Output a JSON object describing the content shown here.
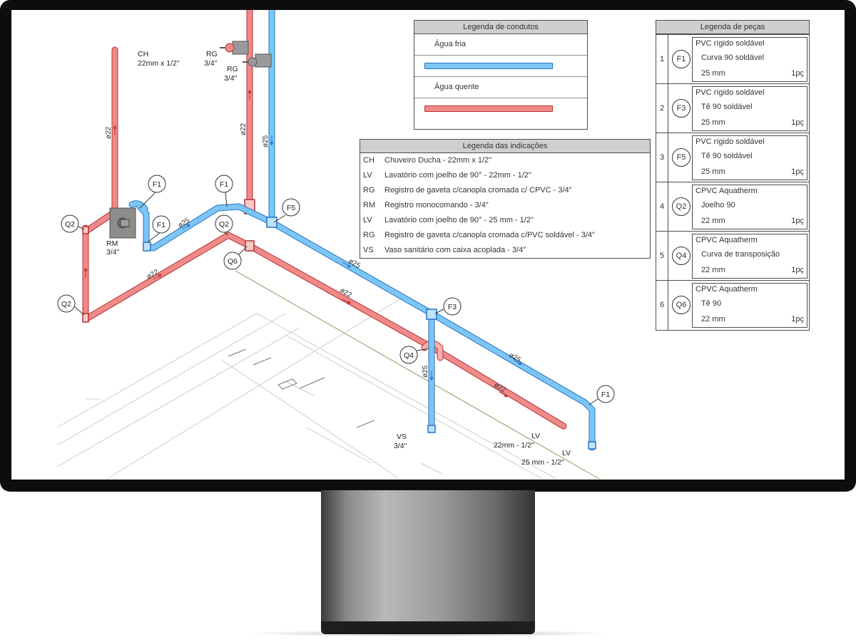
{
  "colors": {
    "cold": "#5bb7ef",
    "cold_dark": "#2a72c4",
    "hot": "#ef7f7f",
    "hot_dark": "#b83030"
  },
  "legend_conduits": {
    "title": "Legenda de condutos",
    "items": [
      {
        "label": "Água fria"
      },
      {
        "label": "Água quente"
      }
    ]
  },
  "legend_indications": {
    "title": "Legenda das indicações",
    "items": [
      {
        "code": "CH",
        "desc": "Chuveiro Ducha - 22mm x 1/2\""
      },
      {
        "code": "LV",
        "desc": "Lavatório com joelho de 90° - 22mm - 1/2\""
      },
      {
        "code": "RG",
        "desc": "Registro de gaveta c/canopla cromada c/ CPVC - 3/4\""
      },
      {
        "code": "RM",
        "desc": "Registro monocomando - 3/4\""
      },
      {
        "code": "LV",
        "desc": "Lavatório com joelho de 90° - 25 mm - 1/2\""
      },
      {
        "code": "RG",
        "desc": "Registro de gaveta c/canopla cromada c/PVC soldável - 3/4\""
      },
      {
        "code": "VS",
        "desc": "Vaso sanitário com caixa acoplada - 3/4\""
      }
    ]
  },
  "legend_parts": {
    "title": "Legenda de peças",
    "items": [
      {
        "num": "1",
        "code": "F1",
        "type": "PVC rígido soldável",
        "name": "Curva 90 soldável",
        "dim": "25 mm",
        "qty": "1pç"
      },
      {
        "num": "2",
        "code": "F3",
        "type": "PVC rígido soldável",
        "name": "Tê 90 soldável",
        "dim": "25 mm",
        "qty": "1pç"
      },
      {
        "num": "3",
        "code": "F5",
        "type": "PVC rígido soldável",
        "name": "Tê 90 soldável",
        "dim": "25 mm",
        "qty": "1pç"
      },
      {
        "num": "4",
        "code": "Q2",
        "type": "CPVC Aquatherm",
        "name": "Joelho 90",
        "dim": "22 mm",
        "qty": "1pç"
      },
      {
        "num": "5",
        "code": "Q4",
        "type": "CPVC Aquatherm",
        "name": "Curva de transposição",
        "dim": "22 mm",
        "qty": "1pç"
      },
      {
        "num": "6",
        "code": "Q6",
        "type": "CPVC Aquatherm",
        "name": "Tê 90",
        "dim": "22 mm",
        "qty": "1pç"
      }
    ]
  },
  "drawing": {
    "ch_code": "CH",
    "ch_spec": "22mm x 1/2\"",
    "rg_code": "RG",
    "rg_size": "3/4\"",
    "rm_code": "RM",
    "rm_size": "3/4\"",
    "vs_code": "VS",
    "vs_size": "3/4\"",
    "lv_code": "LV",
    "lv1_spec": "22mm - 1/2\"",
    "lv2_spec": "25 mm - 1/2\"",
    "diam_22": "ø22",
    "diam_25": "ø25",
    "tag_f1": "F1",
    "tag_f3": "F3",
    "tag_f5": "F5",
    "tag_q2": "Q2",
    "tag_q4": "Q4",
    "tag_q6": "Q6"
  }
}
